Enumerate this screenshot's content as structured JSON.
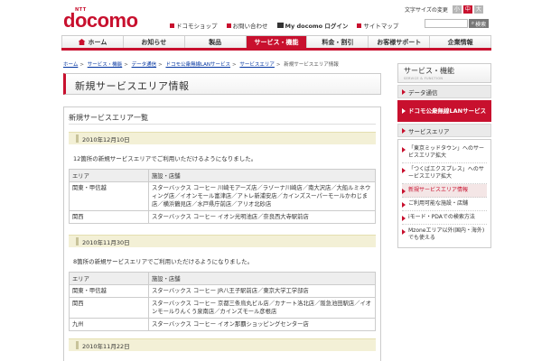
{
  "header": {
    "logo_ntt": "NTT",
    "logo": "docomo",
    "font_size_label": "文字サイズの変更",
    "font_sizes": [
      "小",
      "中",
      "大"
    ],
    "top_links": [
      "ドコモショップ",
      "お問い合わせ",
      "My docomo ログイン",
      "サイトマップ"
    ],
    "search_placeholder": "",
    "search_button": "検索"
  },
  "nav": [
    "ホーム",
    "お知らせ",
    "製品",
    "サービス・機能",
    "料金・割引",
    "お客様サポート",
    "企業情報"
  ],
  "breadcrumb": [
    "ホーム",
    "サービス・機能",
    "データ通信",
    "ドコモ公衆無線LANサービス",
    "サービスエリア",
    "新規サービスエリア情報"
  ],
  "page_title": "新規サービスエリア情報",
  "section_title": "新規サービスエリア一覧",
  "table_headers": [
    "エリア",
    "施設・店舗"
  ],
  "updates": [
    {
      "date": "2010年12月10日",
      "intro": "12箇所の新規サービスエリアでご利用いただけるようになりました。",
      "rows": [
        {
          "region": "関東・甲信越",
          "shops": "スターバックス コーヒー 川崎モアーズ店／ラゾーナ川崎店／南大沢店／大船ルミネウィング店／イオンモール富津店／アトレ新浦安店／カインズスーパーモールかわじま店／横浜鶴見店／水戸県庁前店／アリオ北砂店"
        },
        {
          "region": "関西",
          "shops": "スターバックス コーヒー イオン光明池店／奈良西大寺駅前店"
        }
      ]
    },
    {
      "date": "2010年11月30日",
      "intro": "8箇所の新規サービスエリアでご利用いただけるようになりました。",
      "rows": [
        {
          "region": "関東・甲信越",
          "shops": "スターバックス コーヒー JR八王子駅前店／東京大学工学部店"
        },
        {
          "region": "関西",
          "shops": "スターバックス コーヒー 京都三条烏丸ビル店／カナート洛北店／阪急池田駅店／イオンモールりんくう泉南店／カインズモール彦根店"
        },
        {
          "region": "九州",
          "shops": "スターバックス コーヒー イオン那覇ショッピングセンター店"
        }
      ]
    },
    {
      "date": "2010年11月22日"
    }
  ],
  "sidebar": {
    "title": "サービス・機能",
    "subtitle": "SERVICE & FUNCTION",
    "cat1": "データ通信",
    "cat2": "ドコモ公衆無線LANサービス",
    "cat3": "サービスエリア",
    "items": [
      "「東京ミッドタウン」へのサービスエリア拡大",
      "「つくばエクスプレス」へのサービスエリア拡大",
      "新規サービスエリア情報",
      "ご利用可能な施設・店舗",
      "iモード・PDAでの検索方法",
      "Mzoneエリア以外(国内・海外)でも使える"
    ]
  },
  "colors": {
    "brand": "#c8102e",
    "date_bar": "#f3f0d6"
  }
}
